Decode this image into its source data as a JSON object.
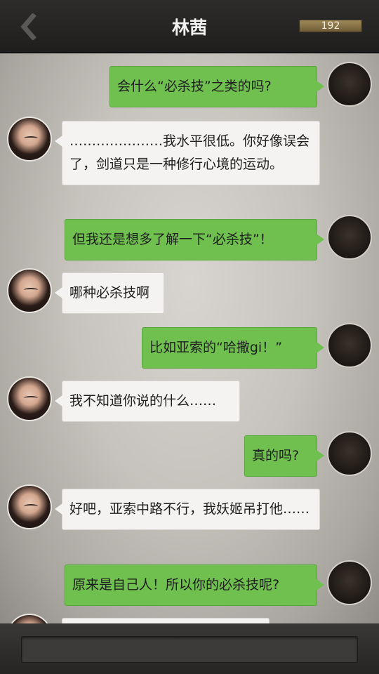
{
  "header": {
    "title": "林茜",
    "counter": "192"
  },
  "messages": [
    {
      "from": "me",
      "text": "会什么“必杀技”之类的吗?"
    },
    {
      "from": "her",
      "text": "…………………我水平很低。你好像误会了，剑道只是一种修行心境的运动。"
    },
    {
      "from": "me",
      "text": "但我还是想多了解一下“必杀技”！"
    },
    {
      "from": "her",
      "text": "哪种必杀技啊"
    },
    {
      "from": "me",
      "text": "比如亚索的“哈撒gi！”"
    },
    {
      "from": "her",
      "text": "我不知道你说的什么……"
    },
    {
      "from": "me",
      "text": "真的吗?"
    },
    {
      "from": "her",
      "text": "好吧，亚索中路不行，我妖姬吊打他……"
    },
    {
      "from": "me",
      "text": "原来是自己人！所以你的必杀技呢?"
    }
  ],
  "input": {
    "placeholder": ""
  }
}
